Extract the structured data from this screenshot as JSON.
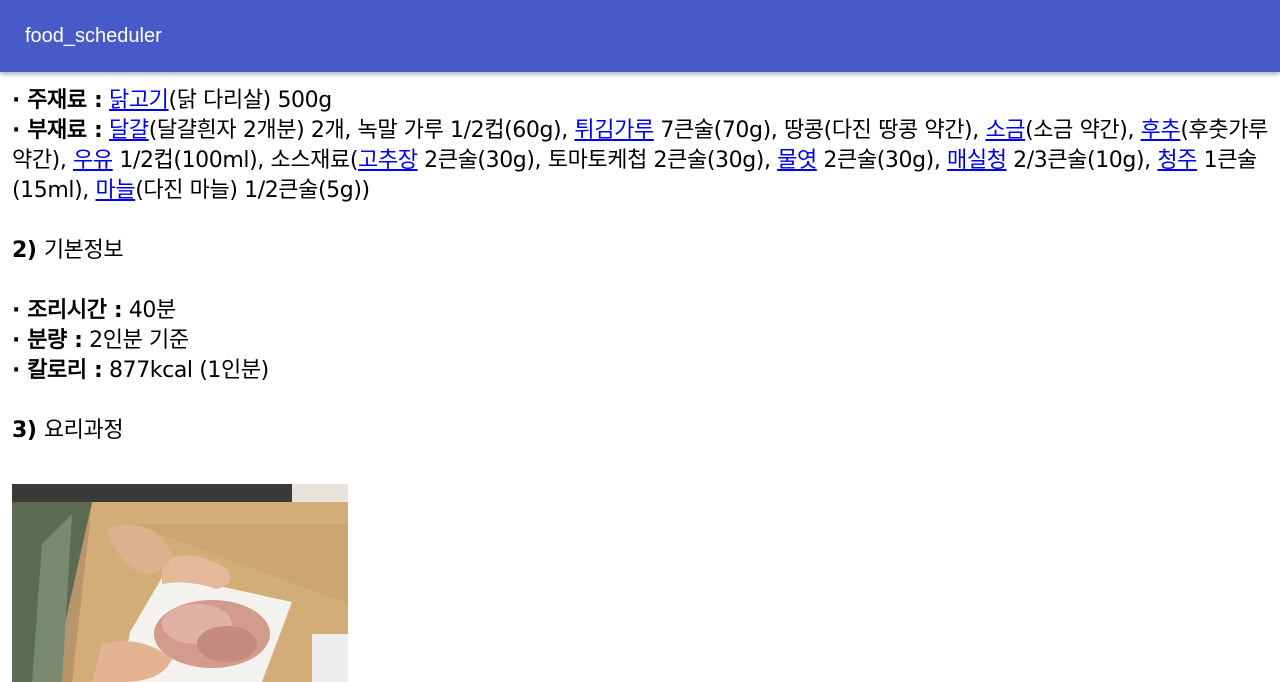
{
  "appbar": {
    "title": "food_scheduler",
    "color": "#475ac8"
  },
  "ingredients": {
    "main_label": "· 주재료 :",
    "main_link": "닭고기",
    "main_rest": "(닭 다리살) 500g",
    "sub_label": "· 부재료 :",
    "sub_segments": [
      {
        "type": "link",
        "text": "달걀"
      },
      {
        "type": "text",
        "text": "(달걀흰자 2개분) 2개, 녹말 가루 1/2컵(60g), "
      },
      {
        "type": "link",
        "text": "튀김가루"
      },
      {
        "type": "text",
        "text": " 7큰술(70g), 땅콩(다진 땅콩 약간), "
      },
      {
        "type": "link",
        "text": "소금"
      },
      {
        "type": "text",
        "text": "(소금 약간), "
      },
      {
        "type": "link",
        "text": "후추"
      },
      {
        "type": "text",
        "text": "(후춧가루 약간), "
      },
      {
        "type": "link",
        "text": "우유"
      },
      {
        "type": "text",
        "text": " 1/2컵(100ml), 소스재료("
      },
      {
        "type": "link",
        "text": "고추장"
      },
      {
        "type": "text",
        "text": " 2큰술(30g), 토마토케첩 2큰술(30g), "
      },
      {
        "type": "link",
        "text": "물엿"
      },
      {
        "type": "text",
        "text": " 2큰술(30g), "
      },
      {
        "type": "link",
        "text": "매실청"
      },
      {
        "type": "text",
        "text": " 2/3큰술(10g), "
      },
      {
        "type": "link",
        "text": "청주"
      },
      {
        "type": "text",
        "text": " 1큰술(15ml), "
      },
      {
        "type": "link",
        "text": "마늘"
      },
      {
        "type": "text",
        "text": "(다진 마늘) 1/2큰술(5g))"
      }
    ]
  },
  "basic_info": {
    "heading_num": "2)",
    "heading_text": "기본정보",
    "time_label": "· 조리시간 :",
    "time_value": "40분",
    "serving_label": "· 분량 :",
    "serving_value": "2인분 기준",
    "calorie_label": "· 칼로리 :",
    "calorie_value": "877kcal (1인분)"
  },
  "process": {
    "heading_num": "3)",
    "heading_text": "요리과정"
  }
}
